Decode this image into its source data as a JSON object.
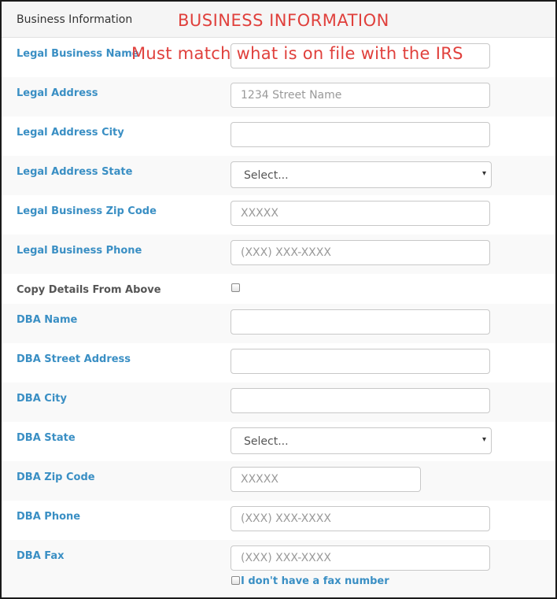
{
  "header": {
    "title": "Business Information",
    "annotation": "BUSINESS INFORMATION"
  },
  "legal_name_annotation": "Must match what is on file with the IRS",
  "fields": {
    "legal_business_name": {
      "label": "Legal Business Name",
      "value": "",
      "placeholder": ""
    },
    "legal_address": {
      "label": "Legal Address",
      "value": "",
      "placeholder": "1234 Street Name"
    },
    "legal_address_city": {
      "label": "Legal Address City",
      "value": "",
      "placeholder": ""
    },
    "legal_address_state": {
      "label": "Legal Address State",
      "selected": "Select..."
    },
    "legal_zip": {
      "label": "Legal Business Zip Code",
      "value": "",
      "placeholder": "XXXXX"
    },
    "legal_phone": {
      "label": "Legal Business Phone",
      "value": "",
      "placeholder": "(XXX) XXX-XXXX"
    },
    "copy_details": {
      "label": "Copy Details From Above",
      "checked": false
    },
    "dba_name": {
      "label": "DBA Name",
      "value": "",
      "placeholder": ""
    },
    "dba_street": {
      "label": "DBA Street Address",
      "value": "",
      "placeholder": ""
    },
    "dba_city": {
      "label": "DBA City",
      "value": "",
      "placeholder": ""
    },
    "dba_state": {
      "label": "DBA State",
      "selected": "Select..."
    },
    "dba_zip": {
      "label": "DBA Zip Code",
      "value": "",
      "placeholder": "XXXXX"
    },
    "dba_phone": {
      "label": "DBA Phone",
      "value": "",
      "placeholder": "(XXX) XXX-XXXX"
    },
    "dba_fax": {
      "label": "DBA Fax",
      "value": "",
      "placeholder": "(XXX) XXX-XXXX"
    },
    "no_fax": {
      "label": "I don't have a fax number",
      "checked": false
    }
  },
  "colors": {
    "label_blue": "#3a8fc4",
    "annotation_red": "#e0403c"
  },
  "icons": {
    "select_caret": "▾"
  }
}
